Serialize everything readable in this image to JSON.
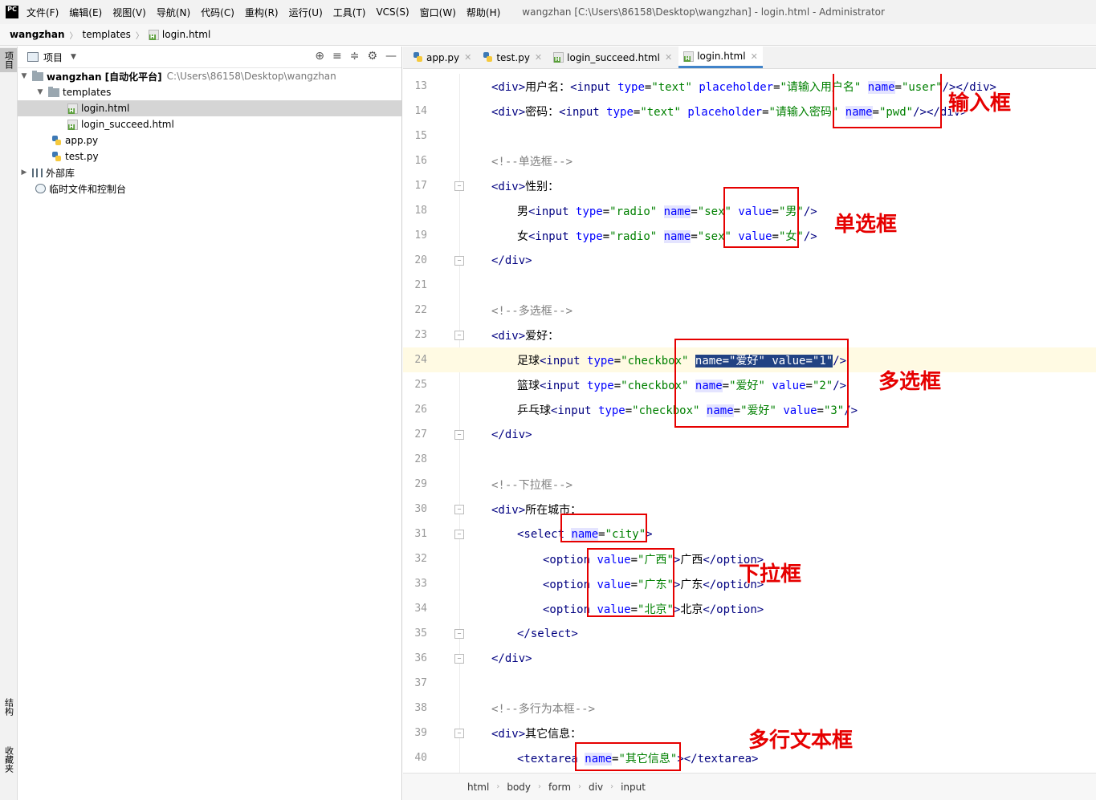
{
  "menubar": {
    "logo": "PC",
    "items": [
      "文件(F)",
      "编辑(E)",
      "视图(V)",
      "导航(N)",
      "代码(C)",
      "重构(R)",
      "运行(U)",
      "工具(T)",
      "VCS(S)",
      "窗口(W)",
      "帮助(H)"
    ],
    "window_title": "wangzhan [C:\\Users\\86158\\Desktop\\wangzhan] - login.html - Administrator"
  },
  "navbar": {
    "crumbs": [
      "wangzhan",
      "templates",
      "login.html"
    ]
  },
  "left_stripe": {
    "tabs": [
      "项目",
      "结构",
      "收藏夹"
    ]
  },
  "project_panel": {
    "title": "项目",
    "tree": [
      {
        "name": "wangzhan [自动化平台]",
        "path": "C:\\Users\\86158\\Desktop\\wangzhan",
        "icon": "folder-icon"
      },
      {
        "name": "templates",
        "icon": "folder-icon"
      },
      {
        "name": "login.html",
        "icon": "html-file-icon"
      },
      {
        "name": "login_succeed.html",
        "icon": "html-file-icon"
      },
      {
        "name": "app.py",
        "icon": "python-file-icon"
      },
      {
        "name": "test.py",
        "icon": "python-file-icon"
      },
      {
        "name": "外部库",
        "icon": "library-icon"
      },
      {
        "name": "临时文件和控制台",
        "icon": "scratch-icon"
      }
    ]
  },
  "editor": {
    "tabs": [
      "app.py",
      "test.py",
      "login_succeed.html",
      "login.html"
    ],
    "active_tab": "login.html",
    "line_numbers": [
      "13",
      "14",
      "15",
      "16",
      "17",
      "18",
      "19",
      "20",
      "21",
      "22",
      "23",
      "24",
      "25",
      "26",
      "27",
      "28",
      "29",
      "30",
      "31",
      "32",
      "33",
      "34",
      "35",
      "36",
      "37",
      "38",
      "39",
      "40"
    ],
    "breadcrumb": [
      "html",
      "body",
      "form",
      "div",
      "input"
    ]
  },
  "code": {
    "l13": {
      "p1": "<div>",
      "p2": "用户名：",
      "p3": "<input ",
      "p4": "type",
      "p5": "=",
      "p6": "\"text\"",
      "p7": " ",
      "p8": "placeholder",
      "p9": "=",
      "p10": "\"请输入用户名\"",
      "p11": " ",
      "p12": "name",
      "p13": "=",
      "p14": "\"user\"",
      "p15": "/></div>"
    },
    "l14": {
      "p1": "<div>",
      "p2": "密码：",
      "p3": "<input ",
      "p4": "type",
      "p5": "=",
      "p6": "\"text\"",
      "p7": " ",
      "p8": "placeholder",
      "p9": "=",
      "p10": "\"请输入密码\"",
      "p11": " ",
      "p12": "name",
      "p13": "=",
      "p14": "\"pwd\"",
      "p15": "/></div>"
    },
    "l16": "<!--单选框-->",
    "l17": {
      "p1": "<div>",
      "p2": "性别："
    },
    "l18": {
      "p1": "男",
      "p2": "<input ",
      "p3": "type",
      "p4": "=",
      "p5": "\"radio\"",
      "p6": " ",
      "p7": "name",
      "p8": "=",
      "p9": "\"sex\"",
      "p10": " ",
      "p11": "value",
      "p12": "=",
      "p13": "\"男\"",
      "p14": "/>"
    },
    "l19": {
      "p1": "女",
      "p2": "<input ",
      "p3": "type",
      "p4": "=",
      "p5": "\"radio\"",
      "p6": " ",
      "p7": "name",
      "p8": "=",
      "p9": "\"sex\"",
      "p10": " ",
      "p11": "value",
      "p12": "=",
      "p13": "\"女\"",
      "p14": "/>"
    },
    "l20": "</div>",
    "l22": "<!--多选框-->",
    "l23": {
      "p1": "<div>",
      "p2": "爱好："
    },
    "l24": {
      "p1": "足球",
      "p2": "<input ",
      "p3": "type",
      "p4": "=",
      "p5": "\"checkbox\"",
      "p6": " ",
      "p7": "name=\"爱好\" value=\"1\"",
      "p8": "/>"
    },
    "l25": {
      "p1": "篮球",
      "p2": "<input ",
      "p3": "type",
      "p4": "=",
      "p5": "\"checkbox\"",
      "p6": " ",
      "p7": "name",
      "p8": "=",
      "p9": "\"爱好\"",
      "p10": " ",
      "p11": "value",
      "p12": "=",
      "p13": "\"2\"",
      "p14": "/>"
    },
    "l26": {
      "p1": "乒乓球",
      "p2": "<input ",
      "p3": "type",
      "p4": "=",
      "p5": "\"checkbox\"",
      "p6": " ",
      "p7": "name",
      "p8": "=",
      "p9": "\"爱好\"",
      "p10": " ",
      "p11": "value",
      "p12": "=",
      "p13": "\"3\"",
      "p14": "/>"
    },
    "l27": "</div>",
    "l29": "<!--下拉框-->",
    "l30": {
      "p1": "<div>",
      "p2": "所在城市："
    },
    "l31": {
      "p1": "<select ",
      "p2": "name",
      "p3": "=",
      "p4": "\"city\"",
      "p5": ">"
    },
    "l32": {
      "p1": "<option ",
      "p2": "value",
      "p3": "=",
      "p4": "\"广西\"",
      "p5": ">",
      "p6": "广西",
      "p7": "</option>"
    },
    "l33": {
      "p1": "<option ",
      "p2": "value",
      "p3": "=",
      "p4": "\"广东\"",
      "p5": ">",
      "p6": "广东",
      "p7": "</option>"
    },
    "l34": {
      "p1": "<option ",
      "p2": "value",
      "p3": "=",
      "p4": "\"北京\"",
      "p5": ">",
      "p6": "北京",
      "p7": "</option>"
    },
    "l35": "</select>",
    "l36": "</div>",
    "l38": "<!--多行为本框-->",
    "l39": {
      "p1": "<div>",
      "p2": "其它信息："
    },
    "l40": {
      "p1": "<textarea ",
      "p2": "name",
      "p3": "=",
      "p4": "\"其它信息\"",
      "p5": "></textarea>"
    }
  },
  "annotations": {
    "input": "输入框",
    "radio": "单选框",
    "checkbox": "多选框",
    "select": "下拉框",
    "textarea": "多行文本框"
  },
  "colors": {
    "tag": "#000080",
    "attr": "#0000ff",
    "value": "#008000",
    "comment": "#808080",
    "annotation": "#e60000",
    "current_line": "#fffae3",
    "selection": "#214283"
  }
}
